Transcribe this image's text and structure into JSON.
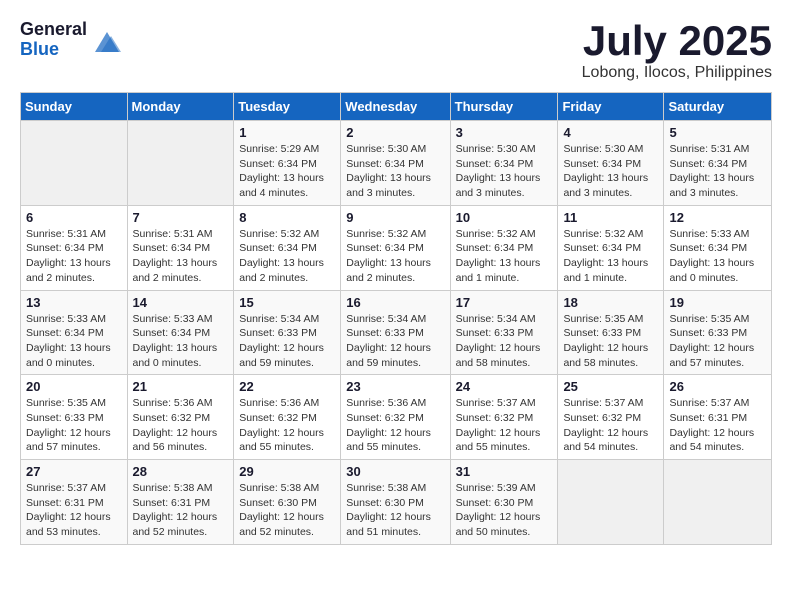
{
  "header": {
    "logo_general": "General",
    "logo_blue": "Blue",
    "month_title": "July 2025",
    "location": "Lobong, Ilocos, Philippines"
  },
  "weekdays": [
    "Sunday",
    "Monday",
    "Tuesday",
    "Wednesday",
    "Thursday",
    "Friday",
    "Saturday"
  ],
  "weeks": [
    [
      {
        "day": "",
        "info": ""
      },
      {
        "day": "",
        "info": ""
      },
      {
        "day": "1",
        "info": "Sunrise: 5:29 AM\nSunset: 6:34 PM\nDaylight: 13 hours and 4 minutes."
      },
      {
        "day": "2",
        "info": "Sunrise: 5:30 AM\nSunset: 6:34 PM\nDaylight: 13 hours and 3 minutes."
      },
      {
        "day": "3",
        "info": "Sunrise: 5:30 AM\nSunset: 6:34 PM\nDaylight: 13 hours and 3 minutes."
      },
      {
        "day": "4",
        "info": "Sunrise: 5:30 AM\nSunset: 6:34 PM\nDaylight: 13 hours and 3 minutes."
      },
      {
        "day": "5",
        "info": "Sunrise: 5:31 AM\nSunset: 6:34 PM\nDaylight: 13 hours and 3 minutes."
      }
    ],
    [
      {
        "day": "6",
        "info": "Sunrise: 5:31 AM\nSunset: 6:34 PM\nDaylight: 13 hours and 2 minutes."
      },
      {
        "day": "7",
        "info": "Sunrise: 5:31 AM\nSunset: 6:34 PM\nDaylight: 13 hours and 2 minutes."
      },
      {
        "day": "8",
        "info": "Sunrise: 5:32 AM\nSunset: 6:34 PM\nDaylight: 13 hours and 2 minutes."
      },
      {
        "day": "9",
        "info": "Sunrise: 5:32 AM\nSunset: 6:34 PM\nDaylight: 13 hours and 2 minutes."
      },
      {
        "day": "10",
        "info": "Sunrise: 5:32 AM\nSunset: 6:34 PM\nDaylight: 13 hours and 1 minute."
      },
      {
        "day": "11",
        "info": "Sunrise: 5:32 AM\nSunset: 6:34 PM\nDaylight: 13 hours and 1 minute."
      },
      {
        "day": "12",
        "info": "Sunrise: 5:33 AM\nSunset: 6:34 PM\nDaylight: 13 hours and 0 minutes."
      }
    ],
    [
      {
        "day": "13",
        "info": "Sunrise: 5:33 AM\nSunset: 6:34 PM\nDaylight: 13 hours and 0 minutes."
      },
      {
        "day": "14",
        "info": "Sunrise: 5:33 AM\nSunset: 6:34 PM\nDaylight: 13 hours and 0 minutes."
      },
      {
        "day": "15",
        "info": "Sunrise: 5:34 AM\nSunset: 6:33 PM\nDaylight: 12 hours and 59 minutes."
      },
      {
        "day": "16",
        "info": "Sunrise: 5:34 AM\nSunset: 6:33 PM\nDaylight: 12 hours and 59 minutes."
      },
      {
        "day": "17",
        "info": "Sunrise: 5:34 AM\nSunset: 6:33 PM\nDaylight: 12 hours and 58 minutes."
      },
      {
        "day": "18",
        "info": "Sunrise: 5:35 AM\nSunset: 6:33 PM\nDaylight: 12 hours and 58 minutes."
      },
      {
        "day": "19",
        "info": "Sunrise: 5:35 AM\nSunset: 6:33 PM\nDaylight: 12 hours and 57 minutes."
      }
    ],
    [
      {
        "day": "20",
        "info": "Sunrise: 5:35 AM\nSunset: 6:33 PM\nDaylight: 12 hours and 57 minutes."
      },
      {
        "day": "21",
        "info": "Sunrise: 5:36 AM\nSunset: 6:32 PM\nDaylight: 12 hours and 56 minutes."
      },
      {
        "day": "22",
        "info": "Sunrise: 5:36 AM\nSunset: 6:32 PM\nDaylight: 12 hours and 55 minutes."
      },
      {
        "day": "23",
        "info": "Sunrise: 5:36 AM\nSunset: 6:32 PM\nDaylight: 12 hours and 55 minutes."
      },
      {
        "day": "24",
        "info": "Sunrise: 5:37 AM\nSunset: 6:32 PM\nDaylight: 12 hours and 55 minutes."
      },
      {
        "day": "25",
        "info": "Sunrise: 5:37 AM\nSunset: 6:32 PM\nDaylight: 12 hours and 54 minutes."
      },
      {
        "day": "26",
        "info": "Sunrise: 5:37 AM\nSunset: 6:31 PM\nDaylight: 12 hours and 54 minutes."
      }
    ],
    [
      {
        "day": "27",
        "info": "Sunrise: 5:37 AM\nSunset: 6:31 PM\nDaylight: 12 hours and 53 minutes."
      },
      {
        "day": "28",
        "info": "Sunrise: 5:38 AM\nSunset: 6:31 PM\nDaylight: 12 hours and 52 minutes."
      },
      {
        "day": "29",
        "info": "Sunrise: 5:38 AM\nSunset: 6:30 PM\nDaylight: 12 hours and 52 minutes."
      },
      {
        "day": "30",
        "info": "Sunrise: 5:38 AM\nSunset: 6:30 PM\nDaylight: 12 hours and 51 minutes."
      },
      {
        "day": "31",
        "info": "Sunrise: 5:39 AM\nSunset: 6:30 PM\nDaylight: 12 hours and 50 minutes."
      },
      {
        "day": "",
        "info": ""
      },
      {
        "day": "",
        "info": ""
      }
    ]
  ]
}
